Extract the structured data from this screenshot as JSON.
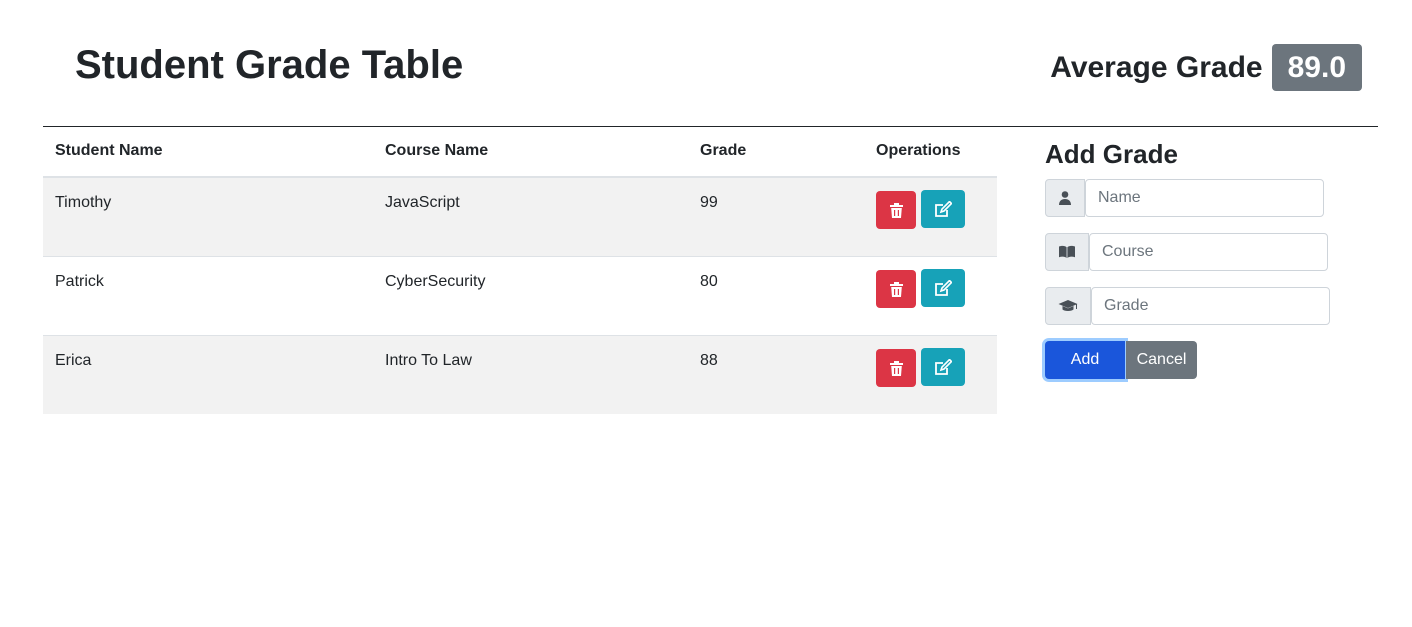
{
  "header": {
    "title": "Student Grade Table",
    "average_label": "Average Grade",
    "average_value": "89.0"
  },
  "table": {
    "columns": [
      "Student Name",
      "Course Name",
      "Grade",
      "Operations"
    ],
    "rows": [
      {
        "student": "Timothy",
        "course": "JavaScript",
        "grade": "99"
      },
      {
        "student": "Patrick",
        "course": "CyberSecurity",
        "grade": "80"
      },
      {
        "student": "Erica",
        "course": "Intro To Law",
        "grade": "88"
      }
    ],
    "row_actions": {
      "delete_icon": "trash-icon",
      "edit_icon": "edit-icon"
    }
  },
  "form": {
    "title": "Add Grade",
    "fields": [
      {
        "icon": "user-icon",
        "placeholder": "Name",
        "value": ""
      },
      {
        "icon": "book-icon",
        "placeholder": "Course",
        "value": ""
      },
      {
        "icon": "graduation-cap-icon",
        "placeholder": "Grade",
        "value": ""
      }
    ],
    "add_label": "Add",
    "cancel_label": "Cancel"
  },
  "colors": {
    "delete": "#dc3545",
    "edit": "#17a2b8",
    "add": "#1a56db",
    "secondary": "#6c757d"
  }
}
